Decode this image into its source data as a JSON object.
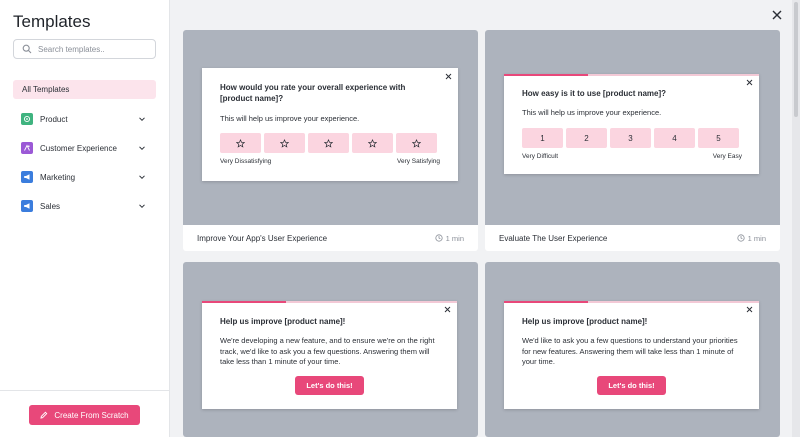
{
  "sidebar": {
    "title": "Templates",
    "search_placeholder": "Search templates..",
    "all_templates_label": "All Templates",
    "categories": [
      {
        "label": "Product",
        "icon": "product-icon",
        "color": "#3fb37f"
      },
      {
        "label": "Customer Experience",
        "icon": "customer-experience-icon",
        "color": "#9b59d6"
      },
      {
        "label": "Marketing",
        "icon": "megaphone-icon",
        "color": "#3b7ddd"
      },
      {
        "label": "Sales",
        "icon": "sales-icon",
        "color": "#3b7ddd"
      }
    ],
    "create_button": "Create From Scratch"
  },
  "colors": {
    "accent": "#e8487a",
    "accent_light": "#fbd5e0",
    "preview_bg": "#adb3bd"
  },
  "cards": [
    {
      "title": "Improve Your App's User Experience",
      "time": "1 min",
      "question": "How would you rate your overall experience with [product name]?",
      "subtitle": "This will help us improve your experience.",
      "low_label": "Very Dissatisfying",
      "high_label": "Very Satisfying"
    },
    {
      "title": "Evaluate The User Experience",
      "time": "1 min",
      "question": "How easy is it to use [product name]?",
      "subtitle": "This will help us improve your experience.",
      "scale": [
        "1",
        "2",
        "3",
        "4",
        "5"
      ],
      "low_label": "Very Difficult",
      "high_label": "Very Easy"
    },
    {
      "title": "",
      "question": "Help us improve [product name]!",
      "body": "We're developing a new feature, and to ensure we're on the right track, we'd like to ask you a few questions. Answering them will take less than 1 minute of your time.",
      "cta": "Let's do this!"
    },
    {
      "title": "",
      "question": "Help us improve [product name]!",
      "body": "We'd like to ask you a few questions to understand your priorities for new features. Answering them will take less than 1 minute of your time.",
      "cta": "Let's do this!"
    }
  ]
}
